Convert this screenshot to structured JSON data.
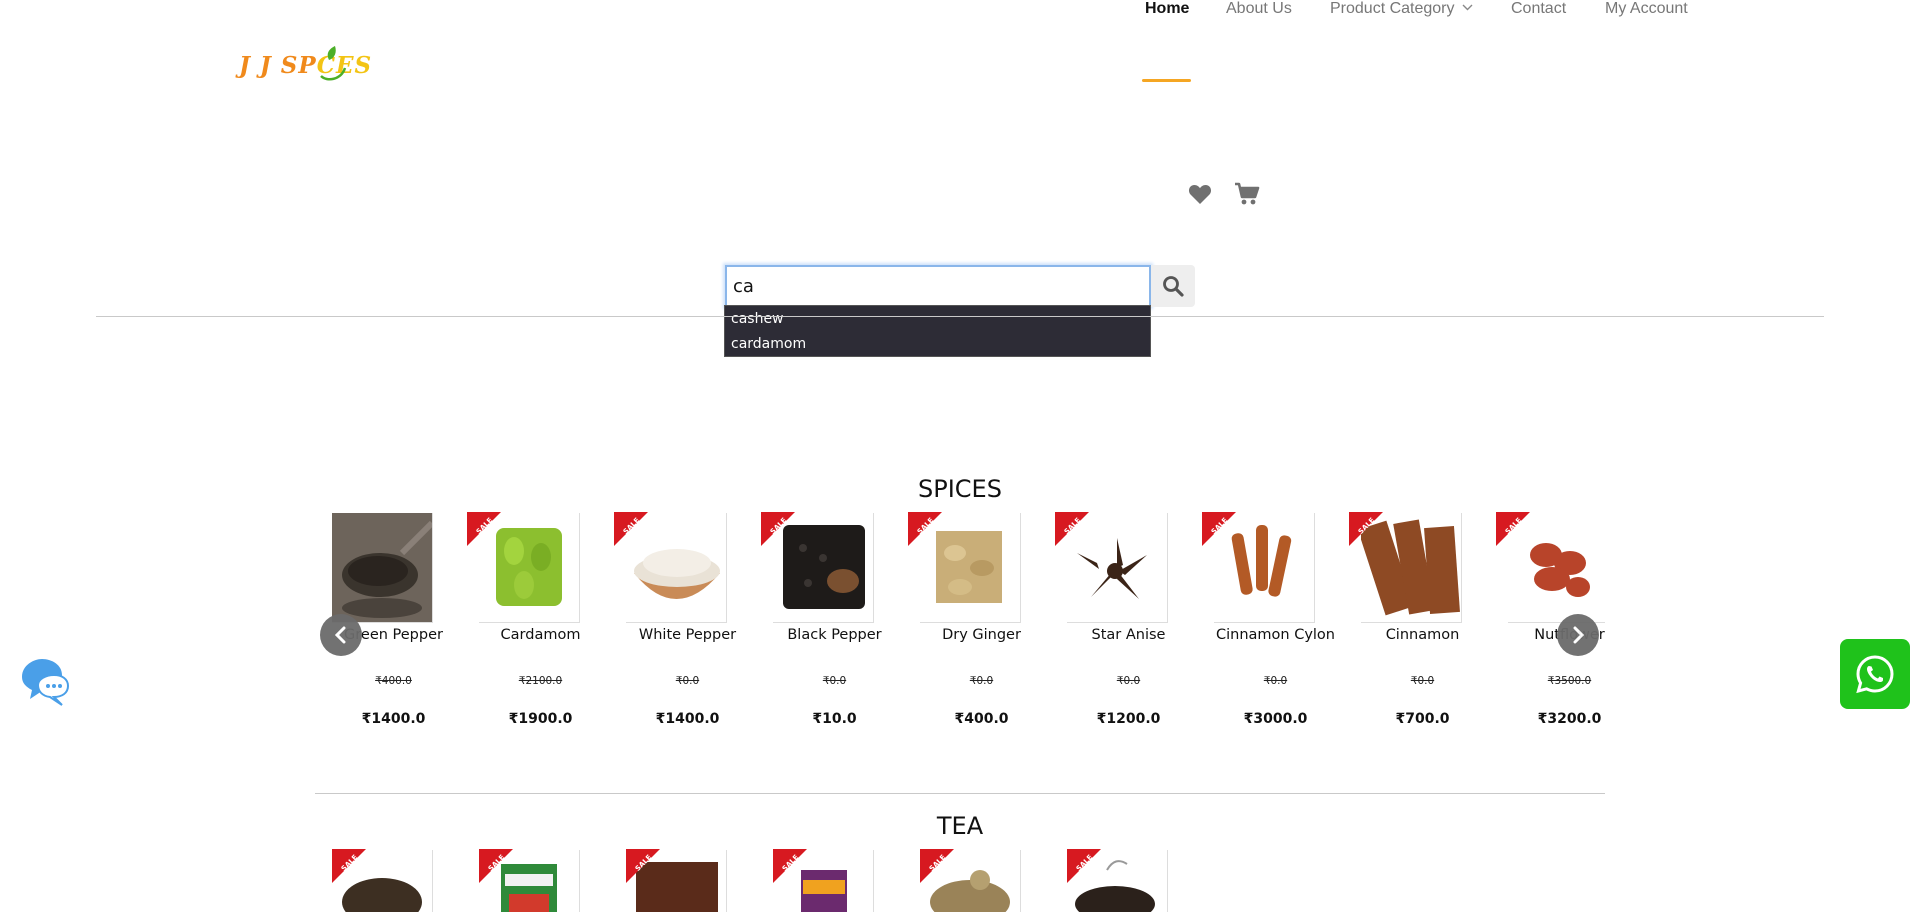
{
  "logo": {
    "text_part1": "J J SP",
    "text_part2": "CES"
  },
  "nav": [
    {
      "label": "Home",
      "active": true
    },
    {
      "label": "About Us"
    },
    {
      "label": "Product Category",
      "has_dropdown": true
    },
    {
      "label": "Contact"
    },
    {
      "label": "My Account"
    }
  ],
  "icons": {
    "wishlist": "heart-icon",
    "cart": "cart-icon",
    "search": "search-icon"
  },
  "search": {
    "value": "ca",
    "suggestions": [
      "cashew",
      "cardamom"
    ]
  },
  "sections": {
    "spices": {
      "title": "SPICES",
      "products": [
        {
          "name": "Green Pepper",
          "old_price": "₹400.0",
          "price": "₹1400.0",
          "sale": false
        },
        {
          "name": "Cardamom",
          "old_price": "₹2100.0",
          "price": "₹1900.0",
          "sale": true
        },
        {
          "name": "White Pepper",
          "old_price": "₹0.0",
          "price": "₹1400.0",
          "sale": true
        },
        {
          "name": "Black Pepper",
          "old_price": "₹0.0",
          "price": "₹10.0",
          "sale": true
        },
        {
          "name": "Dry Ginger",
          "old_price": "₹0.0",
          "price": "₹400.0",
          "sale": true
        },
        {
          "name": "Star Anise",
          "old_price": "₹0.0",
          "price": "₹1200.0",
          "sale": true
        },
        {
          "name": "Cinnamon Cylon",
          "old_price": "₹0.0",
          "price": "₹3000.0",
          "sale": true
        },
        {
          "name": "Cinnamon",
          "old_price": "₹0.0",
          "price": "₹700.0",
          "sale": true
        },
        {
          "name": "Nutflower",
          "old_price": "₹3500.0",
          "price": "₹3200.0",
          "sale": true
        }
      ]
    },
    "tea": {
      "title": "TEA",
      "products": [
        {
          "sale": true
        },
        {
          "sale": true
        },
        {
          "sale": true
        },
        {
          "sale": true
        },
        {
          "sale": true
        },
        {
          "sale": true
        }
      ]
    }
  },
  "badges": {
    "sale": "SALE"
  },
  "colors": {
    "accent": "#f5a623",
    "sale_red": "#d71920",
    "whatsapp": "#1fc21b",
    "suggest_bg": "#2d2c36"
  }
}
